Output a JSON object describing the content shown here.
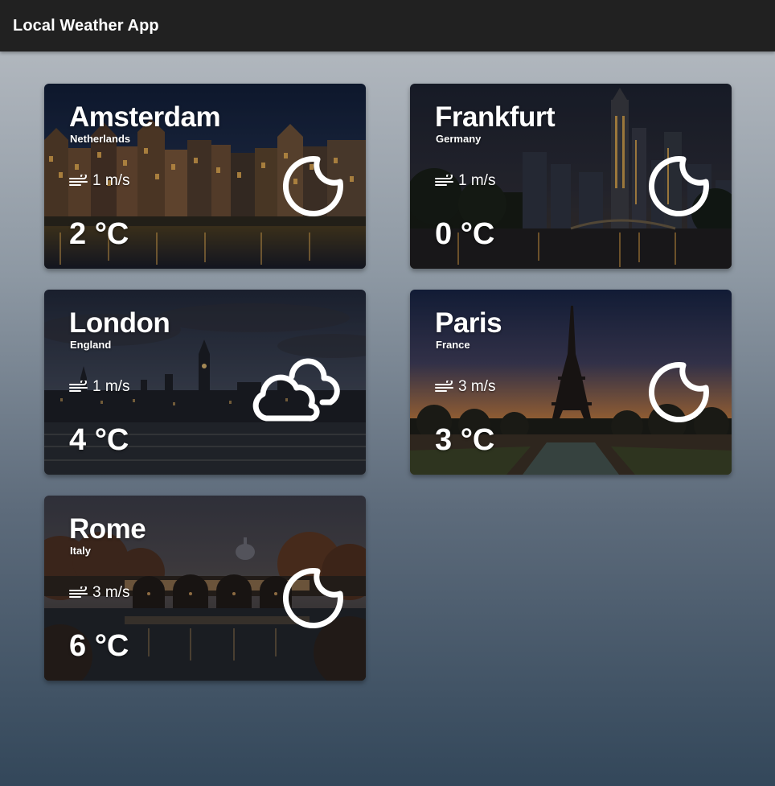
{
  "app": {
    "title": "Local Weather App"
  },
  "cards": [
    {
      "city": "Amsterdam",
      "country": "Netherlands",
      "wind": "1 m/s",
      "temp": "2 °C",
      "condition_icon": "moon-icon"
    },
    {
      "city": "Frankfurt",
      "country": "Germany",
      "wind": "1 m/s",
      "temp": "0 °C",
      "condition_icon": "moon-icon"
    },
    {
      "city": "London",
      "country": "England",
      "wind": "1 m/s",
      "temp": "4 °C",
      "condition_icon": "cloud-icon"
    },
    {
      "city": "Paris",
      "country": "France",
      "wind": "3 m/s",
      "temp": "3 °C",
      "condition_icon": "moon-icon"
    },
    {
      "city": "Rome",
      "country": "Italy",
      "wind": "3 m/s",
      "temp": "6 °C",
      "condition_icon": "moon-icon"
    }
  ],
  "colors": {
    "appbar": "#212121",
    "text": "#ffffff"
  }
}
